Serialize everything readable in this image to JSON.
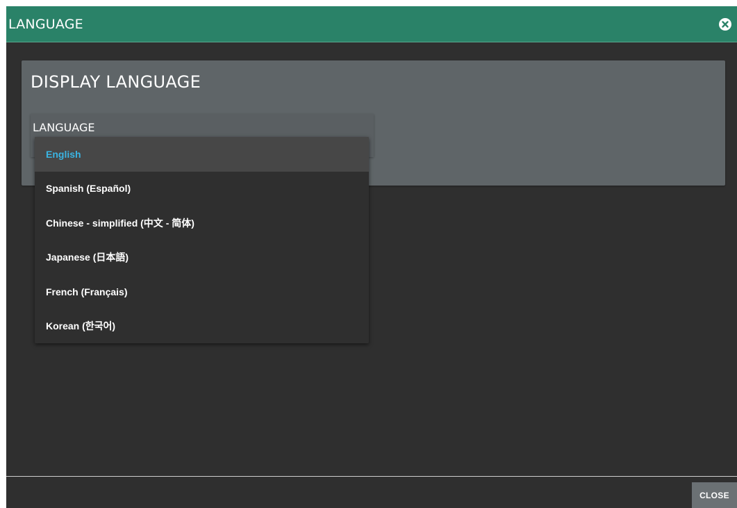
{
  "dialog": {
    "title": "LANGUAGE",
    "close_icon": "close-circle-icon"
  },
  "panel": {
    "title": "DISPLAY LANGUAGE",
    "field_label": "LANGUAGE"
  },
  "dropdown": {
    "selected_index": 0,
    "options": [
      {
        "label": "English"
      },
      {
        "label": "Spanish (Español)"
      },
      {
        "label": "Chinese - simplified (中文 - 简体)"
      },
      {
        "label": "Japanese (日本語)"
      },
      {
        "label": "French (Français)"
      },
      {
        "label": "Korean (한국어)"
      }
    ]
  },
  "footer": {
    "close_label": "CLOSE"
  },
  "colors": {
    "titlebar": "#2a8268",
    "background": "#2f2f2f",
    "panel": "#5f6568",
    "selected_text": "#3ab4e2",
    "selected_bg": "#474747",
    "close_button": "#6b7174"
  }
}
